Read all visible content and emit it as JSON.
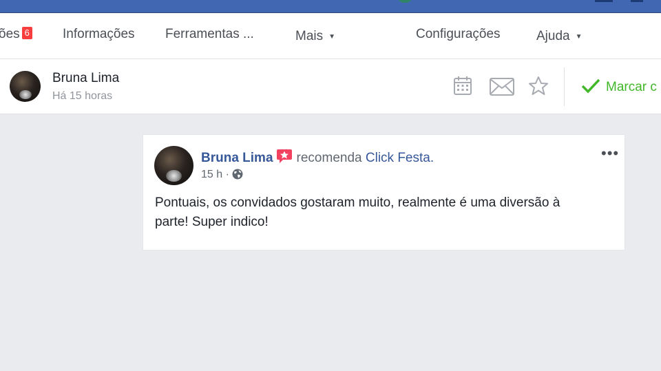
{
  "topbar": {
    "color": "#4267b2"
  },
  "nav": {
    "items": [
      {
        "label": "ões",
        "badge": "6"
      },
      {
        "label": "Informações"
      },
      {
        "label": "Ferramentas ..."
      },
      {
        "label": "Mais"
      },
      {
        "label": "Configurações"
      },
      {
        "label": "Ajuda"
      }
    ]
  },
  "conversation": {
    "name": "Bruna Lima",
    "time": "Há 15 horas",
    "icons": [
      "calendar-icon",
      "envelope-icon",
      "star-icon"
    ],
    "mark_label": "Marcar c"
  },
  "post": {
    "author": "Bruna Lima",
    "verb": "recomenda",
    "page": "Click Festa.",
    "time": "15 h",
    "separator": "·",
    "privacy_icon": "globe-icon",
    "more_icon": "•••",
    "body": "Pontuais, os convidados gostaram muito, realmente é uma diversão à parte! Super indico!"
  },
  "colors": {
    "link": "#365899",
    "success": "#42b72a",
    "badge": "#fa3e3e",
    "recommend": "#f3425f",
    "page_bg": "#e9ebee"
  }
}
